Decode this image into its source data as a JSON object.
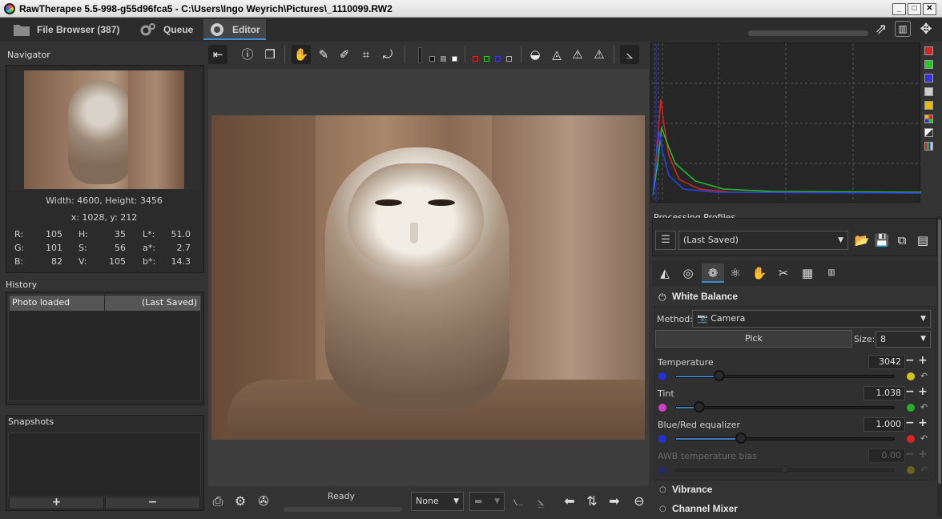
{
  "window": {
    "title": "RawTherapee 5.5-998-g55d96fca5 - C:\\Users\\Ingo Weyrich\\Pictures\\_1110099.RW2",
    "minimize": "_",
    "maximize": "□",
    "close": "✕"
  },
  "tabs": [
    {
      "label": "File Browser (387)",
      "icon": "folder-icon"
    },
    {
      "label": "Queue",
      "icon": "gears-icon"
    },
    {
      "label": "Editor",
      "icon": "aperture-icon"
    }
  ],
  "navigator": {
    "title": "Navigator",
    "size_text": "Width: 4600, Height: 3456",
    "coord_text": "x: 1028, y: 212",
    "readout": {
      "r_label": "R:",
      "r": "105",
      "g_label": "G:",
      "g": "101",
      "b_label": "B:",
      "b": "82",
      "h_label": "H:",
      "h": "35",
      "s_label": "S:",
      "s": "56",
      "v_label": "V:",
      "v": "105",
      "l_label": "L*:",
      "l": "51.0",
      "a_label": "a*:",
      "a": "2.7",
      "bb_label": "b*:",
      "bb": "14.3"
    }
  },
  "history": {
    "title": "History",
    "rows": [
      {
        "action": "Photo loaded",
        "value": "(Last Saved)"
      }
    ]
  },
  "snapshots": {
    "title": "Snapshots",
    "add": "+",
    "remove": "−"
  },
  "status": {
    "text": "Ready",
    "profile_combo": "None"
  },
  "profiles": {
    "title": "Processing Profiles",
    "selected": "(Last Saved)"
  },
  "white_balance": {
    "title": "White Balance",
    "method_label": "Method:",
    "method_value": "Camera",
    "pick_label": "Pick",
    "size_label": "Size:",
    "size_value": "8",
    "temperature": {
      "label": "Temperature",
      "value": "3042",
      "fraction": 0.2
    },
    "tint": {
      "label": "Tint",
      "value": "1.038",
      "fraction": 0.11
    },
    "equalizer": {
      "label": "Blue/Red equalizer",
      "value": "1.000",
      "fraction": 0.3
    },
    "awb_bias": {
      "label": "AWB temperature bias",
      "value": "0.00",
      "fraction": 0.5
    }
  },
  "sections": {
    "vibrance": "Vibrance",
    "channel_mixer": "Channel Mixer"
  },
  "colors": {
    "accent": "#3b8fd6",
    "blue": "#2230d8",
    "yellow": "#d7c21c",
    "magenta": "#d040c8",
    "green": "#22b02a",
    "red": "#d82424"
  }
}
